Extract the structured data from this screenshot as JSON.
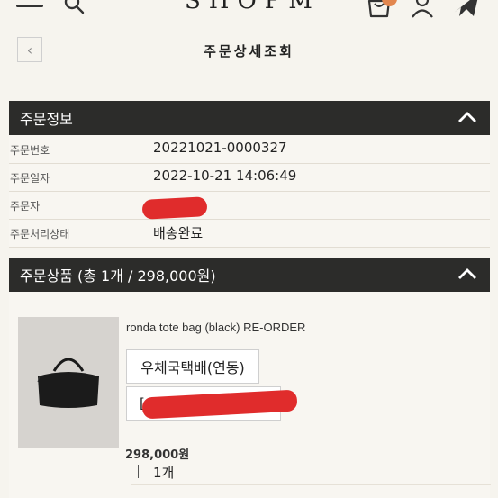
{
  "header": {
    "logo": "SHOPM",
    "cart_count": "0"
  },
  "page": {
    "title": "주문상세조회",
    "back_glyph": "‹"
  },
  "order_info": {
    "heading": "주문정보",
    "rows": [
      {
        "label": "주문번호",
        "value": "20221021-0000327"
      },
      {
        "label": "주문일자",
        "value": "2022-10-21 14:06:49"
      },
      {
        "label": "주문자",
        "value": ""
      },
      {
        "label": "주문처리상태",
        "value": "배송완료"
      }
    ]
  },
  "order_items": {
    "heading": "주문상품 (총 1개 / 298,000원)",
    "item": {
      "name": "ronda tote bag (black) RE-ORDER",
      "shipping_method": "우체국택배(연동)",
      "tracking_prefix": "[",
      "price": "298,000원",
      "quantity": "1개"
    }
  },
  "colors": {
    "header_bar": "#2c2c2a",
    "page_bg": "#f6f4ee",
    "badge": "#e2864e",
    "redaction": "#e02c2c"
  },
  "icons": [
    "hamburger-icon",
    "search-icon",
    "cart-icon",
    "user-icon",
    "plane-icon",
    "chevron-left-icon",
    "chevron-up-icon"
  ]
}
